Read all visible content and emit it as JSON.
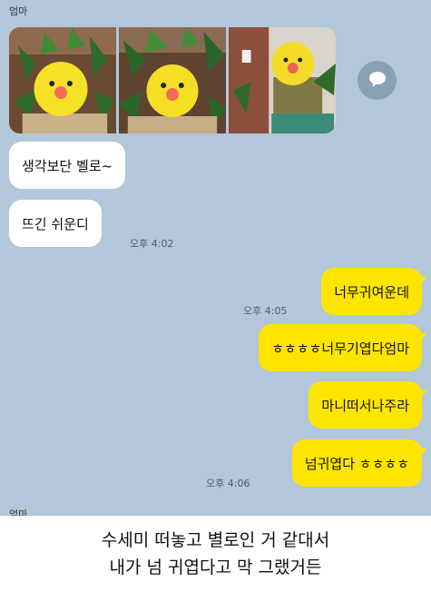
{
  "chat": {
    "sender_name": "엄마",
    "sender_name_bottom": "엄마",
    "photo_count": 3,
    "messages": [
      {
        "side": "in",
        "text": "생각보단 벨로~"
      },
      {
        "side": "in",
        "text": "뜨긴 쉬운디",
        "time": "오후 4:02"
      },
      {
        "side": "out",
        "text": "너무귀여운데",
        "time": "오후 4:05"
      },
      {
        "side": "out",
        "text": "ㅎㅎㅎㅎ너무기엽다엄마"
      },
      {
        "side": "out",
        "text": "마니떠서나주라"
      },
      {
        "side": "out",
        "text": "넘귀엽다 ㅎㅎㅎㅎ",
        "time": "오후 4:06"
      }
    ],
    "share_icon": "speech-bubble-icon",
    "colors": {
      "background": "#b2c7d9",
      "incoming": "#ffffff",
      "outgoing": "#fee500"
    }
  },
  "caption": {
    "line1": "수세미 떠놓고 별로인 거 같대서",
    "line2": "내가 넘 귀엽다고 막 그랬거든"
  }
}
